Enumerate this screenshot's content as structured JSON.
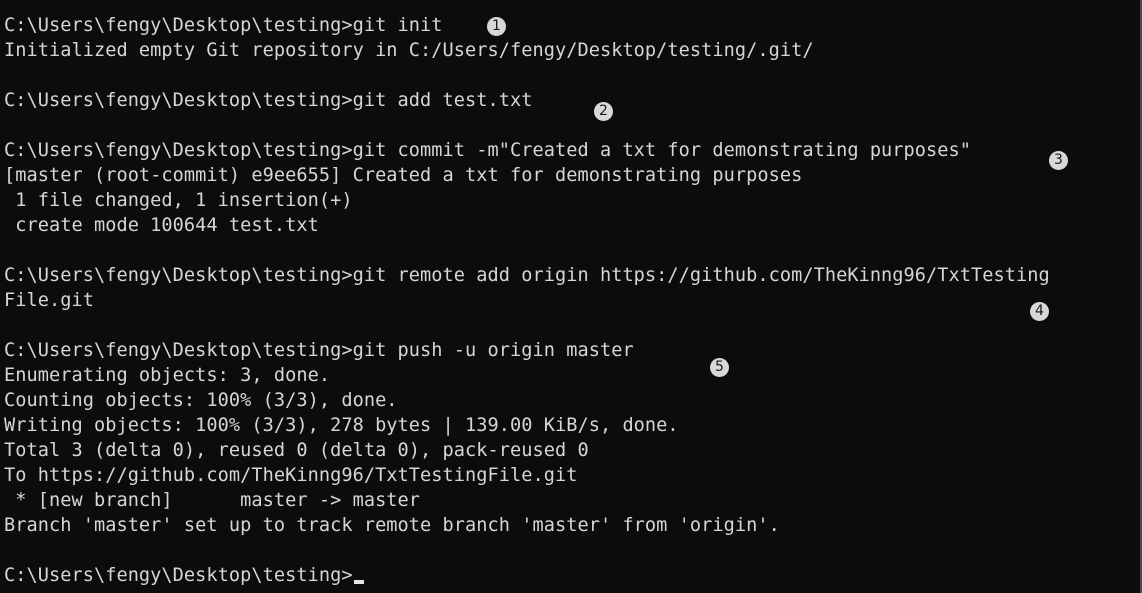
{
  "terminal": {
    "lines": [
      "C:\\Users\\fengy\\Desktop\\testing>git init",
      "Initialized empty Git repository in C:/Users/fengy/Desktop/testing/.git/",
      "",
      "C:\\Users\\fengy\\Desktop\\testing>git add test.txt",
      "",
      "C:\\Users\\fengy\\Desktop\\testing>git commit -m\"Created a txt for demonstrating purposes\"",
      "[master (root-commit) e9ee655] Created a txt for demonstrating purposes",
      " 1 file changed, 1 insertion(+)",
      " create mode 100644 test.txt",
      "",
      "C:\\Users\\fengy\\Desktop\\testing>git remote add origin https://github.com/TheKinng96/TxtTesting",
      "File.git",
      "",
      "C:\\Users\\fengy\\Desktop\\testing>git push -u origin master",
      "Enumerating objects: 3, done.",
      "Counting objects: 100% (3/3), done.",
      "Writing objects: 100% (3/3), 278 bytes | 139.00 KiB/s, done.",
      "Total 3 (delta 0), reused 0 (delta 0), pack-reused 0",
      "To https://github.com/TheKinng96/TxtTestingFile.git",
      " * [new branch]      master -> master",
      "Branch 'master' set up to track remote branch 'master' from 'origin'.",
      ""
    ],
    "prompt": "C:\\Users\\fengy\\Desktop\\testing>"
  },
  "annotations": {
    "step1": "1",
    "step2": "2",
    "step3": "3",
    "step4": "4",
    "step5": "5"
  },
  "colors": {
    "background": "#0c0c0c",
    "text": "#d6d6d6",
    "badge": "#d8d8d8"
  }
}
